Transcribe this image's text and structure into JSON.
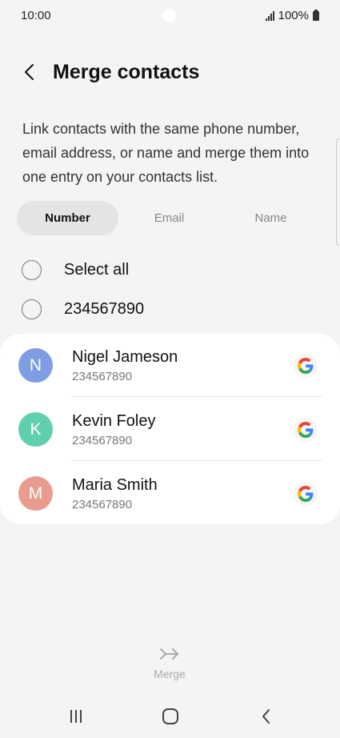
{
  "status": {
    "time": "10:00",
    "battery": "100%"
  },
  "header": {
    "title": "Merge contacts",
    "back_icon": "chevron-left-icon"
  },
  "description": "Link contacts with the same phone number, email address, or name and merge them into one entry on your contacts list.",
  "tabs": [
    {
      "label": "Number",
      "active": true
    },
    {
      "label": "Email",
      "active": false
    },
    {
      "label": "Name",
      "active": false
    }
  ],
  "select_all": {
    "label": "Select all",
    "checked": false
  },
  "group": {
    "label": "234567890",
    "checked": false
  },
  "contacts": [
    {
      "initial": "N",
      "name": "Nigel Jameson",
      "number": "234567890",
      "account_icon": "google-icon",
      "avatar_color": "#7f9de3"
    },
    {
      "initial": "K",
      "name": "Kevin Foley",
      "number": "234567890",
      "account_icon": "google-icon",
      "avatar_color": "#5fcfb0"
    },
    {
      "initial": "M",
      "name": "Maria Smith",
      "number": "234567890",
      "account_icon": "google-icon",
      "avatar_color": "#e99c8d"
    }
  ],
  "merge": {
    "label": "Merge",
    "icon": "merge-arrows-icon",
    "enabled": false
  }
}
